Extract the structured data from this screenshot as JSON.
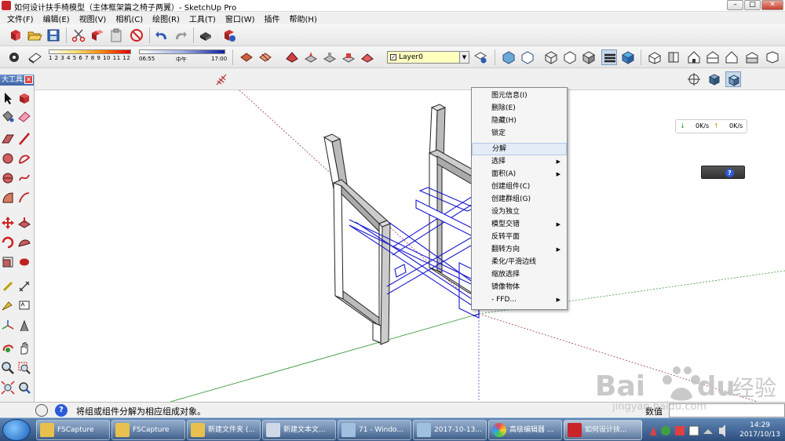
{
  "window": {
    "title": "如何设计扶手椅模型（主体框架篇之椅子两翼）- SketchUp Pro",
    "controls": [
      "–",
      "□",
      "✕"
    ]
  },
  "menu": [
    "文件(F)",
    "编辑(E)",
    "视图(V)",
    "相机(C)",
    "绘图(R)",
    "工具(T)",
    "窗口(W)",
    "插件",
    "帮助(H)"
  ],
  "shadow": {
    "months": "1 2 3 4 5 6 7 8 9 10 11 12",
    "time_start": "06:55",
    "time_mid": "中午",
    "time_end": "17:00"
  },
  "layer": {
    "current": "Layer0"
  },
  "left_panel": {
    "title": "大工具..."
  },
  "context_menu": {
    "items": [
      {
        "label": "图元信息(I)",
        "submenu": false,
        "highlighted": false
      },
      {
        "label": "删除(E)",
        "submenu": false,
        "highlighted": false
      },
      {
        "label": "隐藏(H)",
        "submenu": false,
        "highlighted": false
      },
      {
        "label": "锁定",
        "submenu": false,
        "highlighted": false
      },
      {
        "label": "分解",
        "submenu": false,
        "highlighted": true
      },
      {
        "label": "选择",
        "submenu": true,
        "highlighted": false
      },
      {
        "label": "面积(A)",
        "submenu": true,
        "highlighted": false
      },
      {
        "label": "创建组件(C)",
        "submenu": false,
        "highlighted": false
      },
      {
        "label": "创建群组(G)",
        "submenu": false,
        "highlighted": false
      },
      {
        "label": "设为独立",
        "submenu": false,
        "highlighted": false
      },
      {
        "label": "模型交错",
        "submenu": true,
        "highlighted": false
      },
      {
        "label": "反转平面",
        "submenu": false,
        "highlighted": false
      },
      {
        "label": "翻转方向",
        "submenu": true,
        "highlighted": false
      },
      {
        "label": "柔化/平滑边线",
        "submenu": false,
        "highlighted": false
      },
      {
        "label": "缩放选择",
        "submenu": false,
        "highlighted": false
      },
      {
        "label": "镜像物体",
        "submenu": false,
        "highlighted": false
      },
      {
        "label": "- FFD...",
        "submenu": true,
        "highlighted": false
      }
    ]
  },
  "network_widget": {
    "down": "0K/s",
    "up": "0K/s"
  },
  "mini_widget": {
    "help": "?"
  },
  "status": {
    "text": "将组或组件分解为相应组成对象。",
    "value_label": "数值",
    "value": ""
  },
  "taskbar": {
    "items": [
      {
        "label": "FSCapture",
        "color": "#e8c050"
      },
      {
        "label": "FSCapture",
        "color": "#e8c050"
      },
      {
        "label": "新建文件夹 (...",
        "color": "#e8c050"
      },
      {
        "label": "新建文本文...",
        "color": "#d0d8e8"
      },
      {
        "label": "71 - Windo...",
        "color": "#a0c0e0"
      },
      {
        "label": "2017-10-13...",
        "color": "#a0c0e0"
      },
      {
        "label": "高级编辑器 ...",
        "color": "#f08040"
      },
      {
        "label": "如何设计扶...",
        "color": "#c8242a"
      }
    ],
    "clock_time": "14:29",
    "clock_date": "2017/10/13"
  },
  "watermark": {
    "brand": "Bai",
    "cn": "经验",
    "url": "jingyan.baidu.com"
  },
  "colors": {
    "axis_red": "#a04040",
    "axis_green": "#3a9a3a",
    "axis_blue": "#4060c0",
    "selection": "#1a1ad0",
    "highlight": "#e3ecf7"
  }
}
